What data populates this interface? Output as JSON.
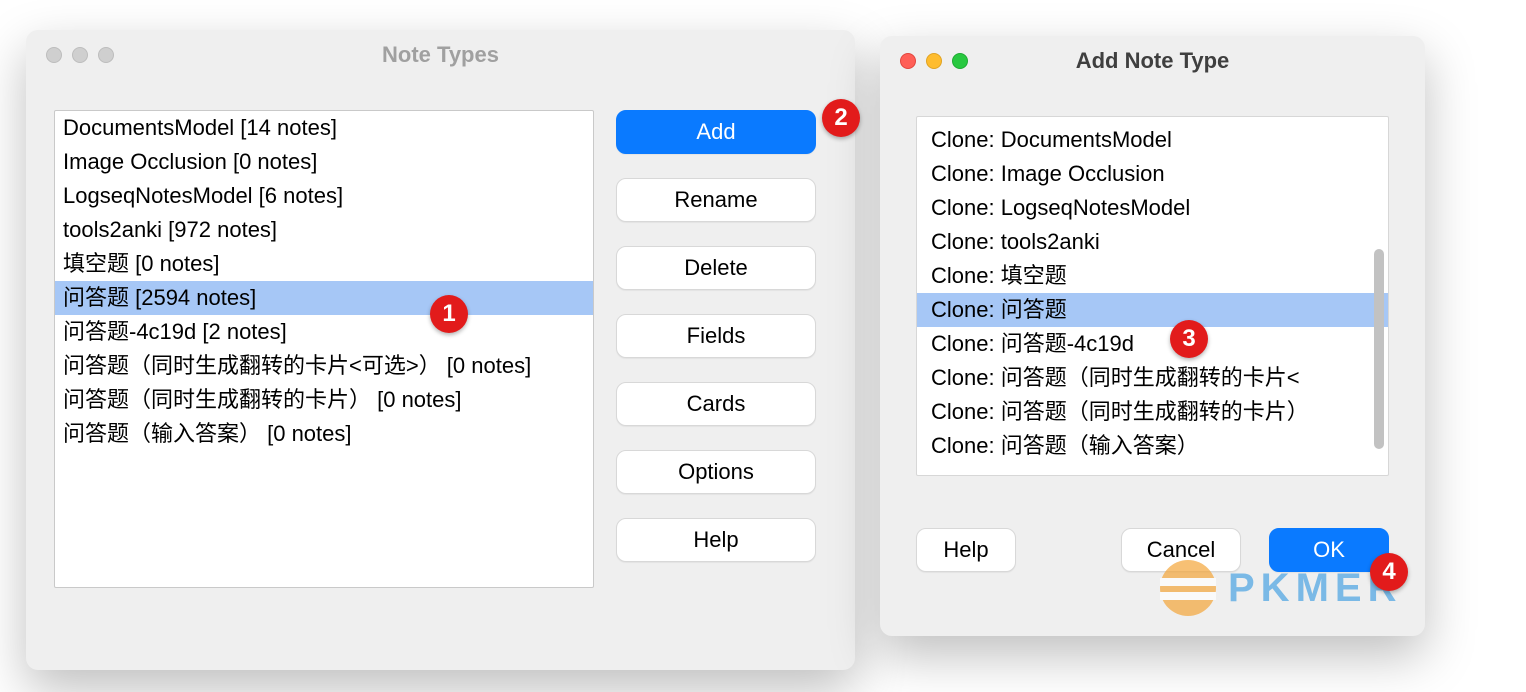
{
  "window1": {
    "title": "Note Types",
    "items": [
      {
        "label": "DocumentsModel [14 notes]",
        "selected": false
      },
      {
        "label": "Image Occlusion [0 notes]",
        "selected": false
      },
      {
        "label": "LogseqNotesModel [6 notes]",
        "selected": false
      },
      {
        "label": "tools2anki [972 notes]",
        "selected": false
      },
      {
        "label": "填空题 [0 notes]",
        "selected": false
      },
      {
        "label": "问答题 [2594 notes]",
        "selected": true
      },
      {
        "label": "问答题-4c19d [2 notes]",
        "selected": false
      },
      {
        "label": "问答题（同时生成翻转的卡片<可选>） [0 notes]",
        "selected": false
      },
      {
        "label": "问答题（同时生成翻转的卡片） [0 notes]",
        "selected": false
      },
      {
        "label": "问答题（输入答案） [0 notes]",
        "selected": false
      }
    ],
    "buttons": {
      "add": "Add",
      "rename": "Rename",
      "delete": "Delete",
      "fields": "Fields",
      "cards": "Cards",
      "options": "Options",
      "help": "Help"
    }
  },
  "window2": {
    "title": "Add Note Type",
    "items": [
      {
        "label": "Clone: DocumentsModel",
        "selected": false
      },
      {
        "label": "Clone: Image Occlusion",
        "selected": false
      },
      {
        "label": "Clone: LogseqNotesModel",
        "selected": false
      },
      {
        "label": "Clone: tools2anki",
        "selected": false
      },
      {
        "label": "Clone: 填空题",
        "selected": false
      },
      {
        "label": "Clone: 问答题",
        "selected": true
      },
      {
        "label": "Clone: 问答题-4c19d",
        "selected": false
      },
      {
        "label": "Clone: 问答题（同时生成翻转的卡片<",
        "selected": false
      },
      {
        "label": "Clone: 问答题（同时生成翻转的卡片）",
        "selected": false
      },
      {
        "label": "Clone: 问答题（输入答案）",
        "selected": false
      }
    ],
    "buttons": {
      "help": "Help",
      "cancel": "Cancel",
      "ok": "OK"
    }
  },
  "annotations": {
    "b1": "1",
    "b2": "2",
    "b3": "3",
    "b4": "4"
  },
  "watermark": {
    "text": "PKMER"
  }
}
